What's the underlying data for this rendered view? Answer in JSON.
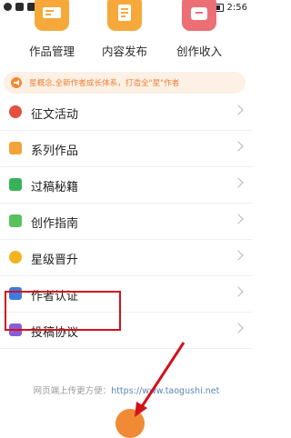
{
  "status_bar": {
    "time": "2:56"
  },
  "top_tiles": [
    {
      "label": "作品管理",
      "icon": "book-management-icon",
      "color": "#f39a2a"
    },
    {
      "label": "内容发布",
      "icon": "publish-document-icon",
      "color": "#f39a2a"
    },
    {
      "label": "创作收入",
      "icon": "income-wallet-icon",
      "color": "#e8646c"
    }
  ],
  "notice": {
    "text": "星概念,全新作者成长体系，打造全\"星\"作者"
  },
  "menu": [
    {
      "label": "征文活动",
      "icon": "contest-icon",
      "color": "#e35040"
    },
    {
      "label": "系列作品",
      "icon": "series-icon",
      "color": "#f2a33a"
    },
    {
      "label": "过稿秘籍",
      "icon": "tips-book-icon",
      "color": "#36b35a"
    },
    {
      "label": "创作指南",
      "icon": "guide-icon",
      "color": "#5bc05e"
    },
    {
      "label": "星级晋升",
      "icon": "star-promotion-icon",
      "color": "#f2b31e"
    },
    {
      "label": "作者认证",
      "icon": "author-verify-icon",
      "color": "#3d7be0"
    },
    {
      "label": "投稿协议",
      "icon": "agreement-icon",
      "color": "#8c5bd6"
    }
  ],
  "footer": {
    "prefix": "网页端上传更方便：",
    "url": "https://www.taogushi.net"
  },
  "colors": {
    "accent": "#f08a35",
    "highlight": "#d3111b"
  }
}
